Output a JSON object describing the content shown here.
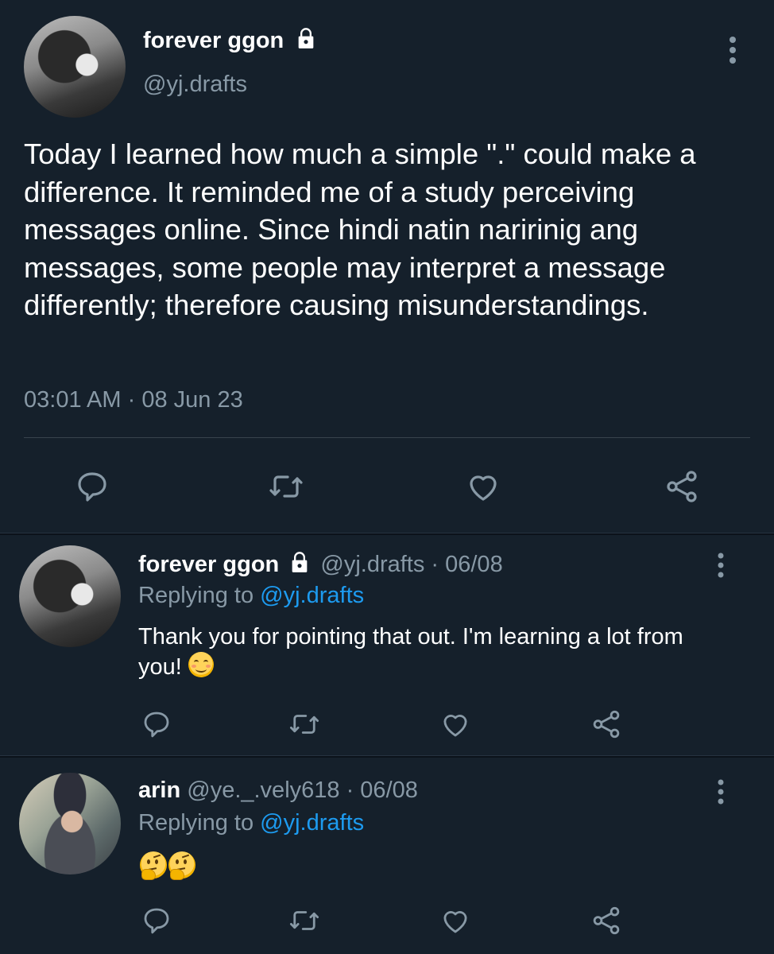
{
  "main_tweet": {
    "display_name": "forever ggon",
    "handle": "@yj.drafts",
    "text": "Today I learned how much a simple \".\" could make a difference. It reminded me of a study perceiving messages online. Since hindi natin naririnig ang messages, some people may interpret a message differently; therefore causing misunderstandings.",
    "time": "03:01 AM",
    "separator": "·",
    "date": "08 Jun 23",
    "protected_icon": "lock-icon",
    "actions": [
      "reply-icon",
      "retweet-icon",
      "like-icon",
      "share-icon"
    ]
  },
  "replies": [
    {
      "display_name": "forever ggon",
      "handle": "@yj.drafts",
      "date": "· 06/08",
      "replying_prefix": "Replying to",
      "replying_to": "@yj.drafts",
      "text": "Thank you for pointing that out. I'm learning a lot from you!",
      "emoji": "smiling-face-emoji"
    },
    {
      "display_name": "arin",
      "handle": "@ye._.vely618",
      "date": "· 06/08",
      "replying_prefix": "Replying to",
      "replying_to": "@yj.drafts",
      "text": "",
      "emoji": "thinking-face-emoji"
    }
  ],
  "colors": {
    "background": "#15202b",
    "muted": "#8899a6",
    "link": "#1d9bf0",
    "text": "#ffffff"
  }
}
